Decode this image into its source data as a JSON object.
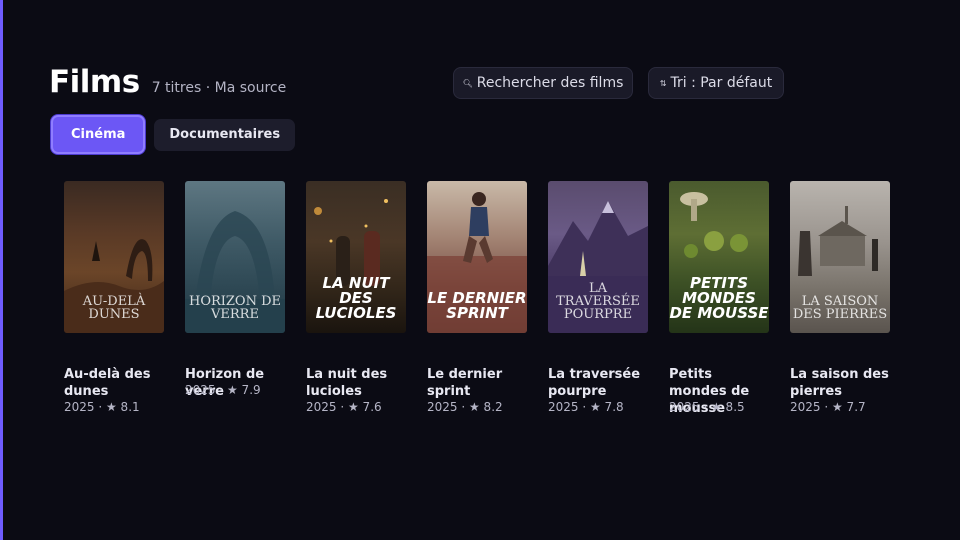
{
  "header": {
    "title": "Films",
    "subtitle": "7 titres · Ma source"
  },
  "search": {
    "label": "Rechercher des films",
    "icon": "search-icon"
  },
  "sort": {
    "label": "Tri : Par défaut",
    "icon": "sort-icon"
  },
  "tabs": [
    {
      "label": "Cinéma",
      "active": true
    },
    {
      "label": "Documentaires",
      "active": false
    }
  ],
  "films": [
    {
      "title": "Au-delà des dunes",
      "poster_title": "Au-delà dunes",
      "year": "2025",
      "rating": "8.1",
      "meta": "2025 · ★ 8.1"
    },
    {
      "title": "Horizon de verre",
      "poster_title": "Horizon de verre",
      "year": "2025",
      "rating": "7.9",
      "meta": "2025 · ★ 7.9"
    },
    {
      "title": "La nuit des lucioles",
      "poster_title": "La Nuit des Lucioles",
      "year": "2025",
      "rating": "7.6",
      "meta": "2025 · ★ 7.6"
    },
    {
      "title": "Le dernier sprint",
      "poster_title": "Le Dernier Sprint",
      "year": "2025",
      "rating": "8.2",
      "meta": "2025 · ★ 8.2"
    },
    {
      "title": "La traversée pourpre",
      "poster_title": "La Traversée Pourpre",
      "year": "2025",
      "rating": "7.8",
      "meta": "2025 · ★ 7.8"
    },
    {
      "title": "Petits mondes de mousse",
      "poster_title": "Petits Mondes de Mousse",
      "year": "2025",
      "rating": "8.5",
      "meta": "2025 · ★ 8.5"
    },
    {
      "title": "La saison des pierres",
      "poster_title": "La Saison des Pierres",
      "year": "2025",
      "rating": "7.7",
      "meta": "2025 · ★ 7.7"
    }
  ],
  "colors": {
    "background": "#0b0b14",
    "accent": "#6c57f5",
    "panel": "#1a1a28"
  }
}
